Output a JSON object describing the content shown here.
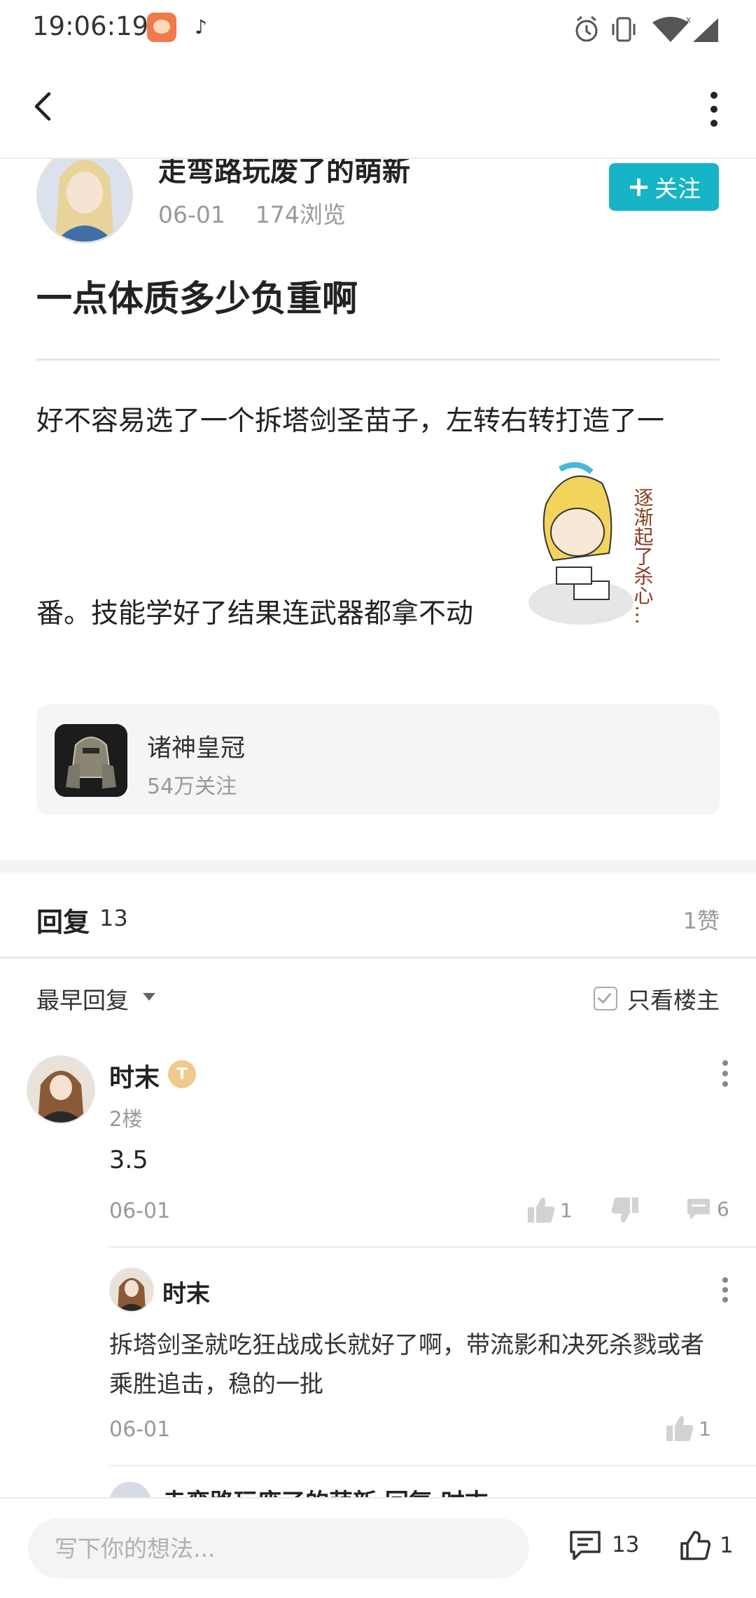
{
  "status_bar": {
    "time": "19:06:19"
  },
  "post": {
    "author_name": "走弯路玩废了的萌新",
    "date": "06-01",
    "views": "174浏览",
    "follow_label": "关注",
    "title": "一点体质多少负重啊",
    "body_line1": "好不容易选了一个拆塔剑圣苗子，左转右转打造了一",
    "body_line2": "番。技能学好了结果连武器都拿不动",
    "sticker_text": "逐渐起了杀心…"
  },
  "game_card": {
    "name": "诸神皇冠",
    "followers": "54万关注"
  },
  "replies_header": {
    "label": "回复",
    "count": "13",
    "likes": "1赞",
    "sort_label": "最早回复",
    "op_only_label": "只看楼主"
  },
  "comments": [
    {
      "author": "时末",
      "badge": "T",
      "floor": "2楼",
      "text": "3.5",
      "date": "06-01",
      "likes": "1",
      "replies": "6",
      "sub_replies": [
        {
          "author": "时末",
          "text": "拆塔剑圣就吃狂战成长就好了啊，带流影和决死杀戮或者乘胜追击，稳的一批",
          "date": "06-01",
          "likes": "1"
        }
      ],
      "next_sub_reply_peek": "走弯路玩废了的萌新 回复 时末"
    }
  ],
  "bottom_bar": {
    "input_placeholder": "写下你的想法...",
    "comment_count": "13",
    "like_count": "1"
  },
  "colors": {
    "accent": "#17b3c6",
    "muted_text": "#999999"
  },
  "icons": [
    "back-icon",
    "more-icon",
    "alarm-icon",
    "vibrate-icon",
    "wifi-icon",
    "signal-icon",
    "thumb-up-icon",
    "thumb-down-icon",
    "chat-icon"
  ]
}
